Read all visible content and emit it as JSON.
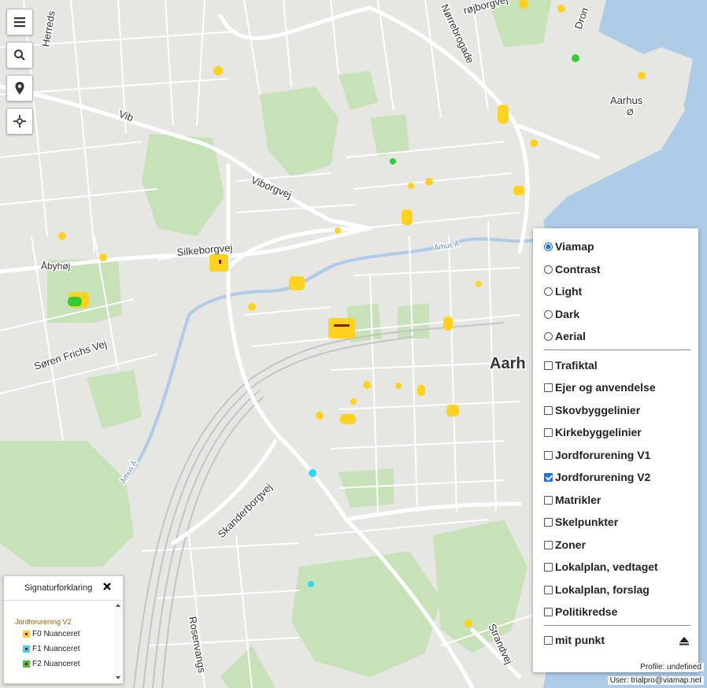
{
  "toolbar": {
    "menu_icon": "hamburger-menu-icon",
    "search_icon": "search-icon",
    "pin_icon": "location-pin-icon",
    "locate_icon": "crosshair-icon"
  },
  "map": {
    "labels": {
      "herredsvej": "Herreds",
      "norrebrogade": "Nørrebrogade",
      "frejsborgvej": "røjborgvej",
      "dronning": "Dron",
      "aarhus_o": "Aarhus",
      "aarhus_o2": "Ø",
      "vib": "Vib",
      "viborgvej": "Viborgvej",
      "silkeborgvej": "Silkeborgvej",
      "abyhoj": "Åbyhøj",
      "aarhus_a": "Århus Å",
      "aarhus_a2": "Århus Å",
      "soren": "Søren Frichs Vej",
      "aarh": "Aarh",
      "skanderborgvej": "Skanderborgvej",
      "rosenvangs": "Rosenvangs",
      "strandvej": "Strandvej"
    },
    "colors": {
      "land": "#e6e6e3",
      "park": "#c7e2b8",
      "water": "#aecbe8",
      "road": "#ffffff",
      "f0": "#ffd21f",
      "f1": "#33d6f2",
      "f2": "#33cc33"
    }
  },
  "layer_panel": {
    "base_layers": [
      {
        "label": "Viamap",
        "selected": true
      },
      {
        "label": "Contrast",
        "selected": false
      },
      {
        "label": "Light",
        "selected": false
      },
      {
        "label": "Dark",
        "selected": false
      },
      {
        "label": "Aerial",
        "selected": false
      }
    ],
    "overlays": [
      {
        "label": "Trafiktal",
        "checked": false
      },
      {
        "label": "Ejer og anvendelse",
        "checked": false
      },
      {
        "label": "Skovbyggelinier",
        "checked": false
      },
      {
        "label": "Kirkebyggelinier",
        "checked": false
      },
      {
        "label": "Jordforurening V1",
        "checked": false
      },
      {
        "label": "Jordforurening V2",
        "checked": true
      },
      {
        "label": "Matrikler",
        "checked": false
      },
      {
        "label": "Skelpunkter",
        "checked": false
      },
      {
        "label": "Zoner",
        "checked": false
      },
      {
        "label": "Lokalplan, vedtaget",
        "checked": false
      },
      {
        "label": "Lokalplan, forslag",
        "checked": false
      },
      {
        "label": "Politikredse",
        "checked": false
      }
    ],
    "mit_punkt": {
      "label": "mit punkt",
      "checked": false
    },
    "eject_icon": "eject-icon"
  },
  "legend": {
    "title": "Signaturforklaring",
    "close_icon": "close-icon",
    "group": "Jordforurening V2",
    "items": [
      {
        "label": "F0 Nuanceret",
        "color": "#ffd21f"
      },
      {
        "label": "F1 Nuanceret",
        "color": "#33d6f2"
      },
      {
        "label": "F2 Nuanceret",
        "color": "#33cc33"
      }
    ]
  },
  "status": {
    "profile": "Profile: undefined",
    "user": "User: trialpro@viamap.net"
  }
}
